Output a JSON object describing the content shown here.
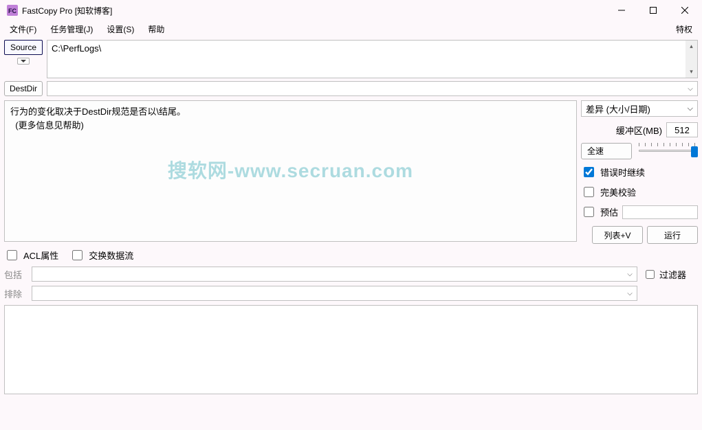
{
  "window": {
    "title": "FastCopy Pro [知软博客]"
  },
  "menu": {
    "file": "文件(F)",
    "task": "任务管理(J)",
    "settings": "设置(S)",
    "help": "帮助",
    "priv": "特权"
  },
  "source": {
    "button": "Source",
    "value": "C:\\PerfLogs\\"
  },
  "dest": {
    "button": "DestDir",
    "value": ""
  },
  "info": {
    "line1": "行为的变化取决于DestDir规范是否以\\结尾。",
    "line2": "  (更多信息见帮助)"
  },
  "watermark": "搜软网-www.secruan.com",
  "mode": {
    "selected": "差异  (大小/日期)"
  },
  "buffer": {
    "label": "缓冲区(MB)",
    "value": "512"
  },
  "speed": {
    "label": "全速"
  },
  "options": {
    "continue_on_error": "错误时继续",
    "perfect_verify": "完美校验",
    "estimate": "预估",
    "acl": "ACL属性",
    "swap_stream": "交换数据流",
    "filter": "过滤器"
  },
  "actions": {
    "list": "列表+V",
    "run": "运行"
  },
  "filters": {
    "include_label": "包括",
    "exclude_label": "排除"
  }
}
